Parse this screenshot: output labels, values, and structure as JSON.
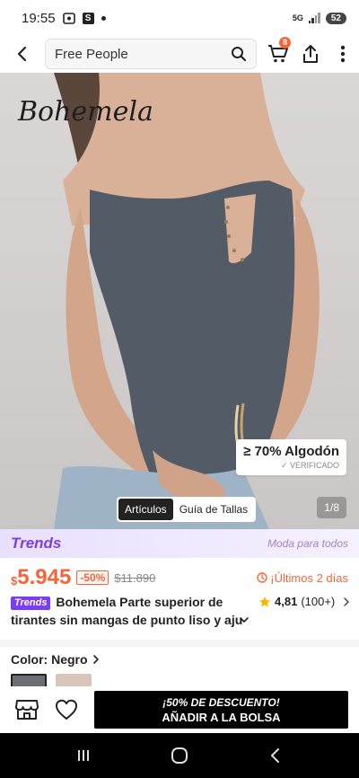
{
  "status_bar": {
    "time": "19:55",
    "network": "5G",
    "battery": "52"
  },
  "header": {
    "search_value": "Free People",
    "cart_count": "8",
    "icons": [
      "back-arrow-icon",
      "search-icon",
      "cart-icon",
      "share-icon",
      "more-icon"
    ]
  },
  "product_image": {
    "brand_logo": "Bohemela",
    "cotton_badge": "≥ 70% Algodón",
    "cotton_verified": "✓ VERIFICADO",
    "gallery_tabs": [
      "Artículos",
      "Guía de Tallas"
    ],
    "active_tab": "Artículos",
    "image_counter": "1/8"
  },
  "trends_banner": {
    "logo": "Trends",
    "tagline": "Moda para todos"
  },
  "price": {
    "currency": "$",
    "current": "5.945",
    "discount": "-50%",
    "original": "$11.890",
    "urgency": "¡Últimos 2 días"
  },
  "product": {
    "badge": "Trends",
    "title": "Bohemela Parte superior de tirantes sin mangas de punto liso y aju",
    "rating": "4,81",
    "review_count": "(100+)"
  },
  "color": {
    "label": "Color: Negro"
  },
  "action_bar": {
    "promo": "¡50% DE DESCUENTO!",
    "add_to_bag": "AÑADIR A LA BOLSA"
  },
  "colors": {
    "accent": "#fa6338",
    "trends_purple": "#7a3df0",
    "star": "#f7b500"
  }
}
